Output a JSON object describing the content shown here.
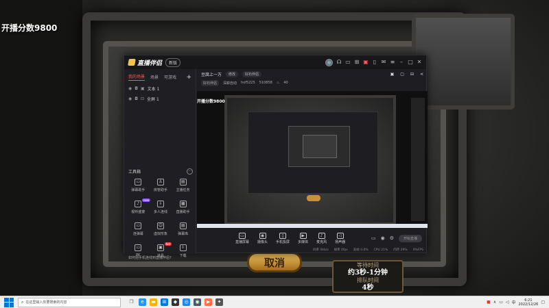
{
  "game": {
    "overlay_title": "开播分数9800",
    "cancel_label": "取消",
    "wait": {
      "line1": "等待时间",
      "line2": "约3秒-1分钟",
      "line3": "排队时间",
      "line4": "4秒"
    }
  },
  "app": {
    "title": "直播伴侣",
    "version_badge": "新版",
    "scene_tabs": [
      "我的场景",
      "场景",
      "可游戏"
    ],
    "scene_tabs_active": 0,
    "sources": [
      {
        "label": "文本 1"
      },
      {
        "label": "全屏 1"
      }
    ],
    "tools_title": "工具箱",
    "tools": [
      {
        "label": "弹幕助手",
        "icon": "▭"
      },
      {
        "label": "房管助手",
        "icon": "♙"
      },
      {
        "label": "主播任务",
        "icon": "▤"
      },
      {
        "label": "视听盛宴",
        "icon": "♪",
        "badge": "new"
      },
      {
        "label": "多人连线",
        "icon": "⇩"
      },
      {
        "label": "直播助手",
        "icon": "▦"
      },
      {
        "label": "连弹幕",
        "icon": "▭"
      },
      {
        "label": "虚拟形象",
        "icon": "☺"
      },
      {
        "label": "弹幕库",
        "icon": "▤"
      },
      {
        "label": "PK",
        "icon": "▭"
      },
      {
        "label": "道具",
        "icon": "▣",
        "badge": "hot"
      },
      {
        "label": "下载",
        "icon": "⇩"
      }
    ],
    "tip": "如何把手机连线到直播伴侣?",
    "room": {
      "title": "豆腐上一万",
      "edit_label": "修改",
      "chip": "好石伴侣",
      "tag": "好石伴侣",
      "info1": "深耕自动",
      "info2": "hof5225",
      "info3": "510858",
      "info4": "40"
    },
    "preview_label": "开播分数9800",
    "controls": [
      {
        "label": "直播屏幕",
        "icon": "▭"
      },
      {
        "label": "摄像头",
        "icon": "◉"
      },
      {
        "label": "手机投屏",
        "icon": "▯"
      },
      {
        "label": "多媒体",
        "icon": "▶"
      },
      {
        "label": "麦克风",
        "icon": "♪"
      },
      {
        "label": "扬声器",
        "icon": "◁"
      }
    ],
    "start_label": "开始直播",
    "status": [
      "码率 0kb/s",
      "帧率 0fps",
      "丢帧 0.0%",
      "CPU 21%",
      "内存 29%",
      "0%FPS"
    ]
  },
  "taskbar": {
    "search_placeholder": "在这里输入你要搜索的内容",
    "time": "6:21",
    "date": "2022/12/26",
    "ime": "中"
  },
  "colors": {
    "accent_red": "#ff5a5a",
    "start_blue": "#0078d7",
    "gold": "#f1c35c"
  }
}
